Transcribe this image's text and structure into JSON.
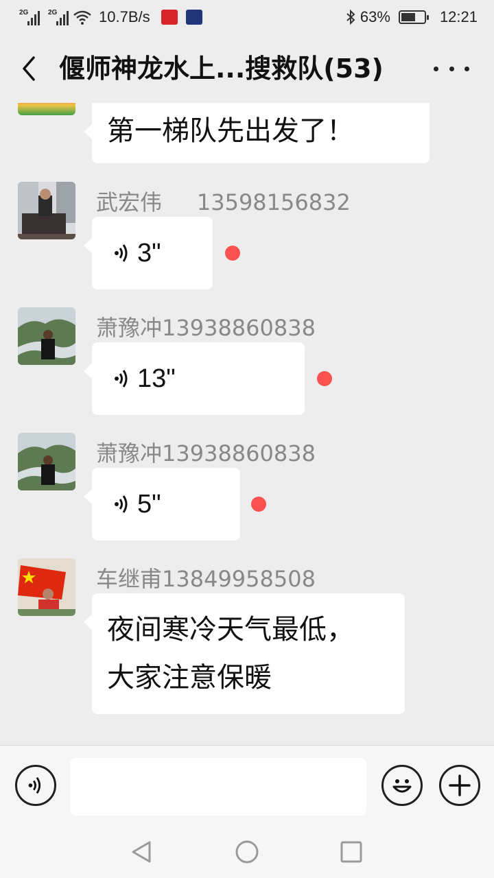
{
  "status_bar": {
    "sim1_label": "2G",
    "sim2_label": "2G",
    "net_speed": "10.7B/s",
    "battery_percent": "63%",
    "battery_level": 0.63,
    "time": "12:21",
    "icons": [
      "signal-icon",
      "signal-icon",
      "wifi-icon",
      "netease-app-icon",
      "news-app-icon",
      "bluetooth-icon",
      "battery-icon"
    ]
  },
  "header": {
    "title": "偃师神龙水上...搜救队(53)",
    "back_icon": "chevron-left-icon",
    "more_icon": "more-dots-icon"
  },
  "messages": [
    {
      "type": "text",
      "sender": "",
      "text": "第一梯队先出发了！",
      "avatar": "flowers-avatar"
    },
    {
      "type": "voice",
      "sender": "武宏伟     13598156832",
      "duration": "3\"",
      "unread": true,
      "avatar": "man-in-chair-avatar"
    },
    {
      "type": "voice",
      "sender": "萧豫冲13938860838",
      "duration": "13\"",
      "unread": true,
      "avatar": "river-landscape-avatar"
    },
    {
      "type": "voice",
      "sender": "萧豫冲13938860838",
      "duration": "5\"",
      "unread": true,
      "avatar": "river-landscape-avatar"
    },
    {
      "type": "text",
      "sender": "车继甫13849958508",
      "text_lines": [
        "夜间寒冷天气最低，",
        "大家注意保暖"
      ],
      "avatar": "flag-avatar"
    }
  ],
  "input_bar": {
    "voice_icon": "voice-input-icon",
    "emoji_icon": "emoji-icon",
    "plus_icon": "plus-icon",
    "value": ""
  },
  "colors": {
    "background": "#ededed",
    "bubble": "#ffffff",
    "unread_dot": "#fa5151",
    "sender_name": "#888888"
  }
}
